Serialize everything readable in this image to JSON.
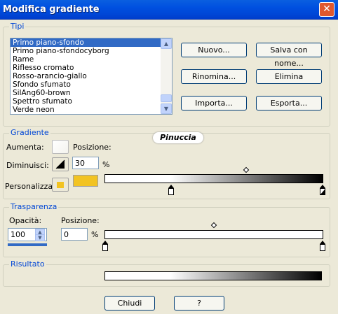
{
  "window": {
    "title": "Modifica gradiente",
    "close_glyph": "✕"
  },
  "watermark": "Pinuccia",
  "tipi": {
    "label": "Tipi",
    "items": [
      {
        "label": "Primo piano-sfondo",
        "selected": true
      },
      {
        "label": "Primo piano-sfondocyborg",
        "selected": false
      },
      {
        "label": "Rame",
        "selected": false
      },
      {
        "label": "Riflesso cromato",
        "selected": false
      },
      {
        "label": "Rosso-arancio-giallo",
        "selected": false
      },
      {
        "label": "Sfondo sfumato",
        "selected": false
      },
      {
        "label": "SilAng60-brown",
        "selected": false
      },
      {
        "label": "Spettro sfumato",
        "selected": false
      },
      {
        "label": "Verde neon",
        "selected": false
      }
    ],
    "buttons": {
      "nuovo": "Nuovo...",
      "salva": "Salva con nome...",
      "rinomina": "Rinomina...",
      "elimina": "Elimina",
      "importa": "Importa...",
      "esporta": "Esporta..."
    }
  },
  "gradiente": {
    "label": "Gradiente",
    "aumenta": "Aumenta:",
    "posizione": "Posizione:",
    "diminuisci": "Diminuisci:",
    "position_value": "30",
    "percent": "%",
    "personalizza": "Personalizza:",
    "custom_color": "#f2c322"
  },
  "trasparenza": {
    "label": "Trasparenza",
    "opacita": "Opacità:",
    "opacity_value": "100",
    "posizione": "Posizione:",
    "position_value": "0",
    "percent": "%"
  },
  "risultato": {
    "label": "Risultato"
  },
  "footer": {
    "chiudi": "Chiudi",
    "help": "?"
  },
  "icons": {
    "close": "close-icon",
    "scroll_up": "chevron-up-icon",
    "scroll_down": "chevron-down-icon"
  }
}
